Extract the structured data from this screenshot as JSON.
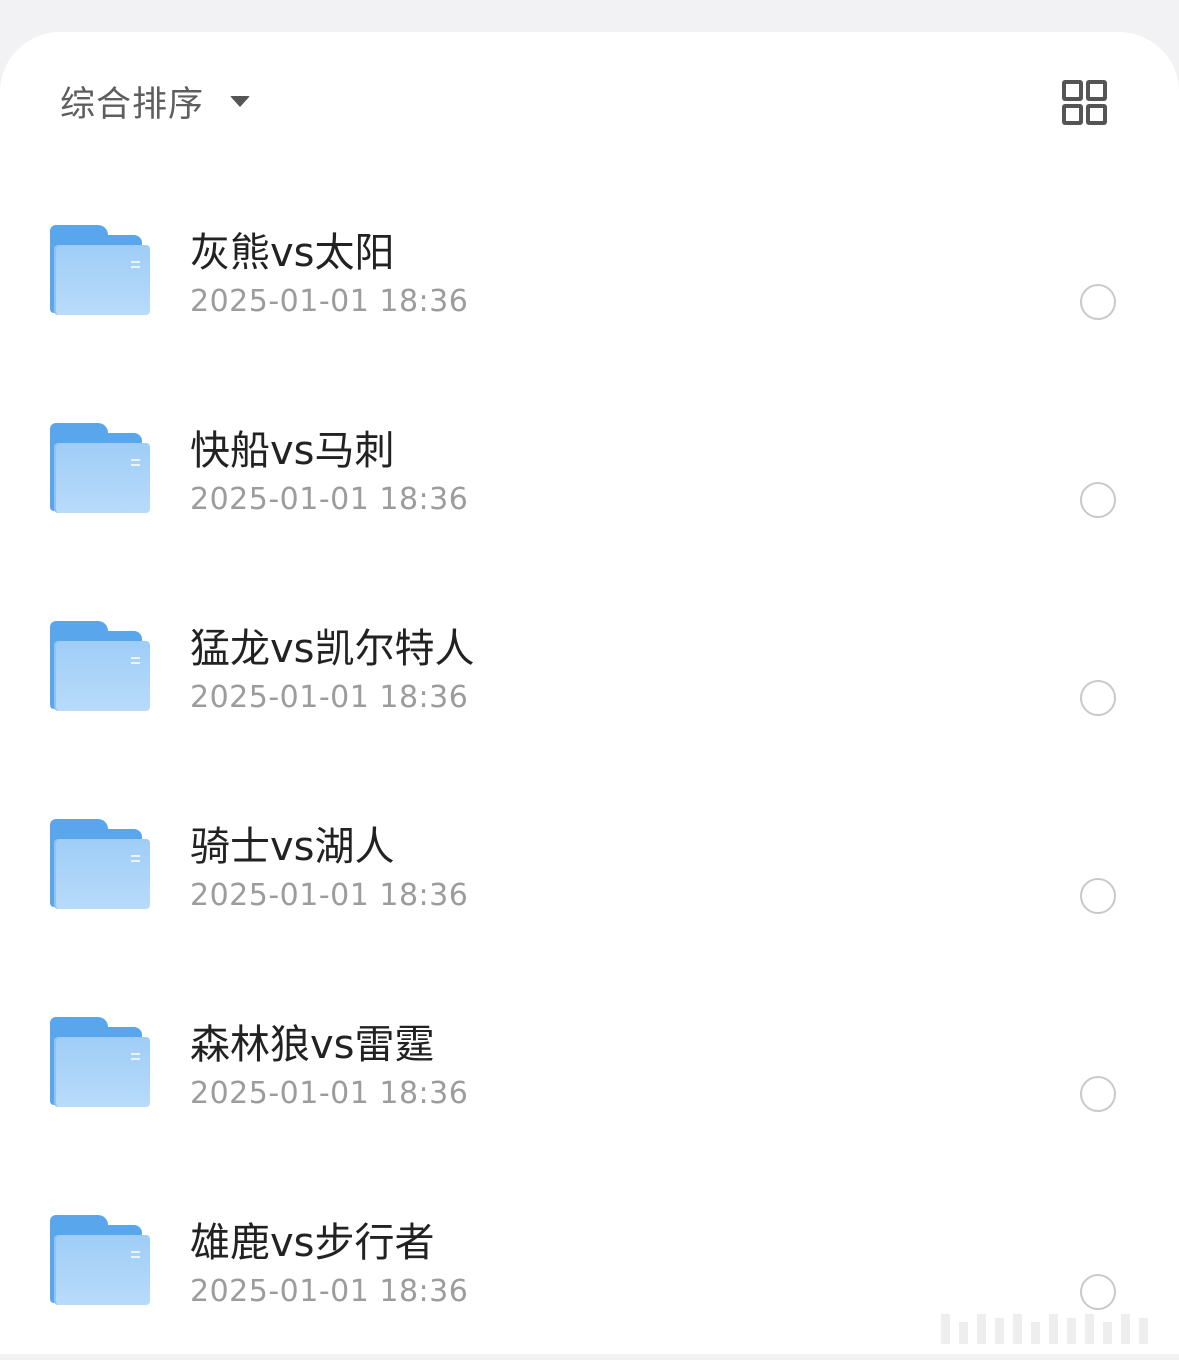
{
  "toolbar": {
    "sort_label": "综合排序",
    "sort_icon": "caret-down-icon",
    "view_toggle_icon": "grid-view-icon"
  },
  "colors": {
    "folder": "#5aa6ec",
    "folder_front": "#a9d3f8",
    "title_text": "#222222",
    "date_text": "#9c9c9c",
    "radio_border": "#c9c9c9"
  },
  "files": [
    {
      "name": "灰熊vs太阳",
      "date": "2025-01-01 18:36",
      "icon": "folder-icon",
      "selected": false
    },
    {
      "name": "快船vs马刺",
      "date": "2025-01-01 18:36",
      "icon": "folder-icon",
      "selected": false
    },
    {
      "name": "猛龙vs凯尔特人",
      "date": "2025-01-01 18:36",
      "icon": "folder-icon",
      "selected": false
    },
    {
      "name": "骑士vs湖人",
      "date": "2025-01-01 18:36",
      "icon": "folder-icon",
      "selected": false
    },
    {
      "name": "森林狼vs雷霆",
      "date": "2025-01-01 18:36",
      "icon": "folder-icon",
      "selected": false
    },
    {
      "name": "雄鹿vs步行者",
      "date": "2025-01-01 18:36",
      "icon": "folder-icon",
      "selected": false
    }
  ]
}
